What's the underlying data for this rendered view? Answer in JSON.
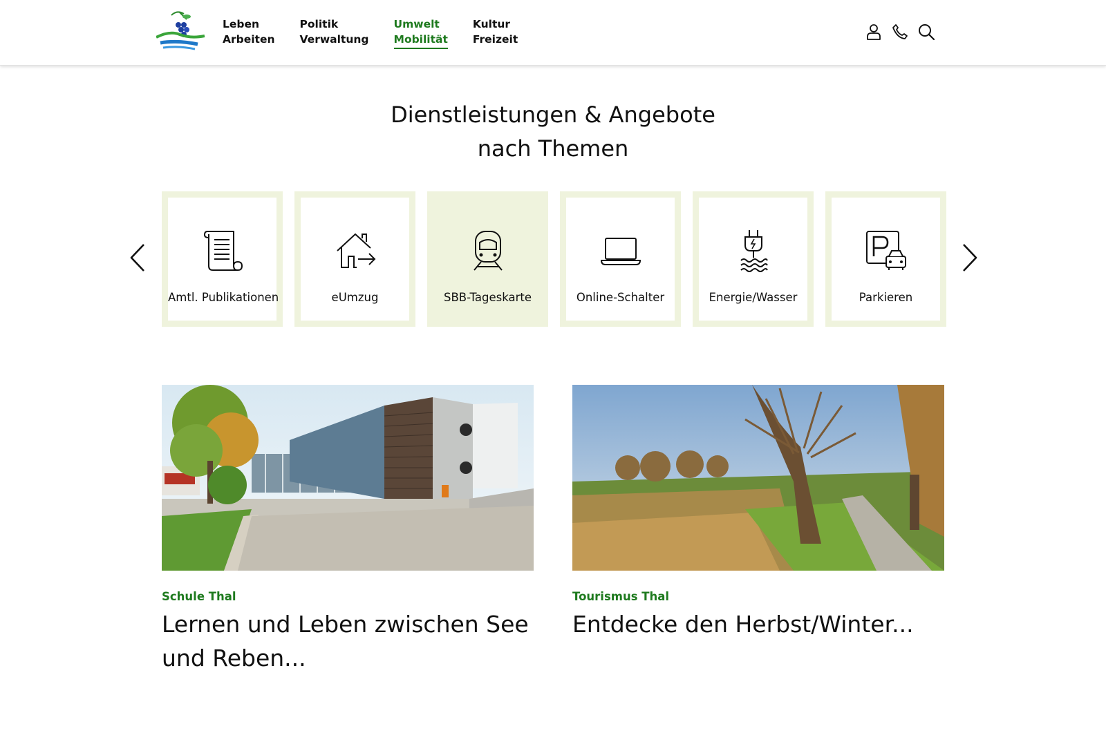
{
  "header": {
    "nav": [
      {
        "line1": "Leben",
        "line2": "Arbeiten",
        "active": false
      },
      {
        "line1": "Politik",
        "line2": "Verwaltung",
        "active": false
      },
      {
        "line1": "Umwelt",
        "line2": "Mobilität",
        "active": true
      },
      {
        "line1": "Kultur",
        "line2": "Freizeit",
        "active": false
      }
    ],
    "icons": [
      "user-icon",
      "phone-icon",
      "search-icon"
    ],
    "accent_color": "#1e7a1e"
  },
  "services": {
    "title_line1": "Dienstleistungen & Angebote",
    "title_line2": "nach Themen",
    "tiles": [
      {
        "label": "Amtl. Publikationen",
        "icon": "document-scroll-icon",
        "active": false
      },
      {
        "label": "eUmzug",
        "icon": "house-move-icon",
        "active": false
      },
      {
        "label": "SBB-Tageskarte",
        "icon": "train-icon",
        "active": true
      },
      {
        "label": "Online-Schalter",
        "icon": "laptop-icon",
        "active": false
      },
      {
        "label": "Energie/Wasser",
        "icon": "plug-water-icon",
        "active": false
      },
      {
        "label": "Parkieren",
        "icon": "parking-car-icon",
        "active": false
      }
    ],
    "tile_border_color": "#eff3dd"
  },
  "cards": [
    {
      "kicker": "Schule Thal",
      "title": "Lernen und Leben zwischen See und Reben...",
      "image": "school-building-photo"
    },
    {
      "kicker": "Tourismus Thal",
      "title": "Entdecke den Herbst/Winter...",
      "image": "autumn-landscape-photo"
    }
  ]
}
